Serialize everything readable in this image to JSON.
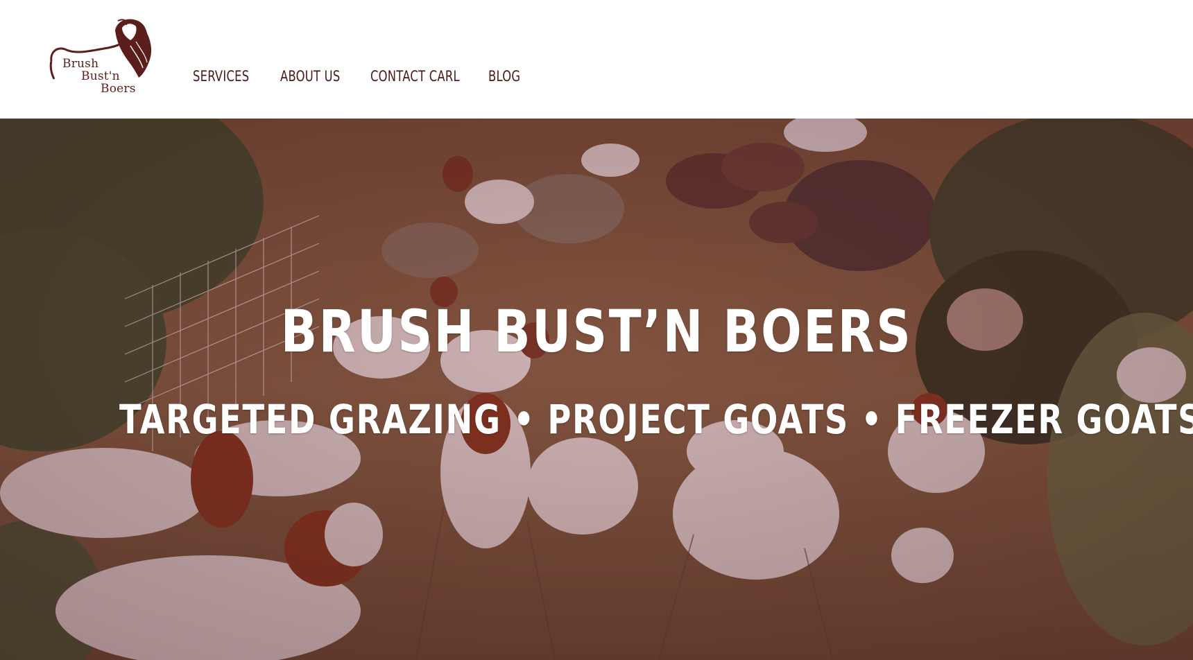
{
  "brand": {
    "logo_line1": "Brush",
    "logo_line2": "Bust'n",
    "logo_line3": "Boers",
    "color": "#5c1e1a"
  },
  "nav": {
    "items": [
      {
        "label": "SERVICES"
      },
      {
        "label": "ABOUT US"
      },
      {
        "label": "CONTACT CARL"
      },
      {
        "label": "BLOG"
      }
    ]
  },
  "hero": {
    "title": "BRUSH BUST’N BOERS",
    "subtitle": "TARGETED GRAZING • PROJECT GOATS • FREEZER GOATS",
    "overlay_color": "#6e1e28"
  },
  "icons": {
    "logo": "goat-head-logo-icon"
  }
}
